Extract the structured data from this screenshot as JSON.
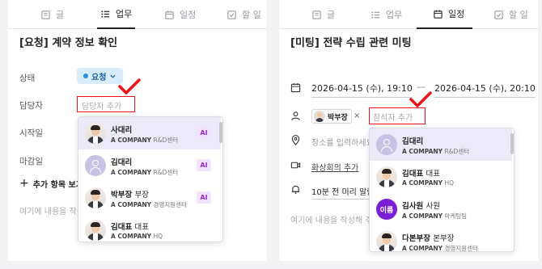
{
  "left": {
    "tabs": [
      {
        "label": "글",
        "icon": "document-icon",
        "active": false
      },
      {
        "label": "업무",
        "icon": "list-icon",
        "active": true
      },
      {
        "label": "일정",
        "icon": "calendar-icon",
        "active": false
      },
      {
        "label": "할 일",
        "icon": "checkbox-icon",
        "active": false
      }
    ],
    "title": "[요청] 계약 정보 확인",
    "status_label": "상태",
    "status_value": "요청",
    "assignee_label": "담당자",
    "assignee_placeholder": "담당자 추가",
    "start_label": "시작일",
    "due_label": "마감일",
    "add_item_label": "추가 항목 보기",
    "content_placeholder": "여기에 내용을 작성",
    "dropdown": [
      {
        "name": "사대리",
        "position": "",
        "company": "A COMPANY",
        "dept": "R&D센터",
        "avatar": "photo",
        "ai": "AI",
        "highlighted": true
      },
      {
        "name": "김대리",
        "position": "",
        "company": "A COMPANY",
        "dept": "R&D센터",
        "avatar": "placeholder",
        "ai": "AI",
        "highlighted": false
      },
      {
        "name": "박부장",
        "position": "부장",
        "company": "A COMPANY",
        "dept": "경영지원센터",
        "avatar": "photo",
        "ai": "AI",
        "highlighted": false
      },
      {
        "name": "김대표",
        "position": "대표",
        "company": "A COMPANY",
        "dept": "HQ",
        "avatar": "photo",
        "ai": "",
        "highlighted": false
      }
    ]
  },
  "right": {
    "tabs": [
      {
        "label": "글",
        "icon": "document-icon",
        "active": false
      },
      {
        "label": "업무",
        "icon": "list-icon",
        "active": false
      },
      {
        "label": "일정",
        "icon": "calendar-icon",
        "active": true
      },
      {
        "label": "할 일",
        "icon": "checkbox-icon",
        "active": false
      }
    ],
    "title": "[미팅] 전략 수립 관련 미팅",
    "start_datetime": "2026-04-15 (수), 19:10",
    "end_datetime": "2026-04-15 (수), 20:10",
    "date_separator": "—",
    "attendee_chip": "박부장",
    "chip_close": "×",
    "attendee_placeholder": "참석자 추가",
    "location_placeholder": "장소를 입력하세요",
    "meeting_link": "화상회의 추가",
    "reminder": "10분 전 미리 알림",
    "content_placeholder": "여기에 내용을 작성해 주세",
    "dropdown": [
      {
        "name": "김대리",
        "position": "",
        "company": "A COMPANY",
        "dept": "R&D센터",
        "avatar": "placeholder",
        "highlighted": true
      },
      {
        "name": "김대표",
        "position": "대표",
        "company": "A COMPANY",
        "dept": "HQ",
        "avatar": "photo",
        "highlighted": false
      },
      {
        "name": "김사원",
        "position": "사원",
        "company": "A COMPANY",
        "dept": "마케팅팀",
        "avatar": "initial",
        "initial": "이름",
        "highlighted": false
      },
      {
        "name": "다본부장",
        "position": "본부장",
        "company": "A COMPANY",
        "dept": "경영지원센터",
        "avatar": "photo",
        "highlighted": false
      }
    ]
  },
  "colors": {
    "accent_red": "#e11111",
    "highlight": "#ece9f9",
    "ai_badge": "#9a2bd0",
    "status_blue": "#2a8ee3",
    "initial_avatar": "#7a1fd6"
  }
}
